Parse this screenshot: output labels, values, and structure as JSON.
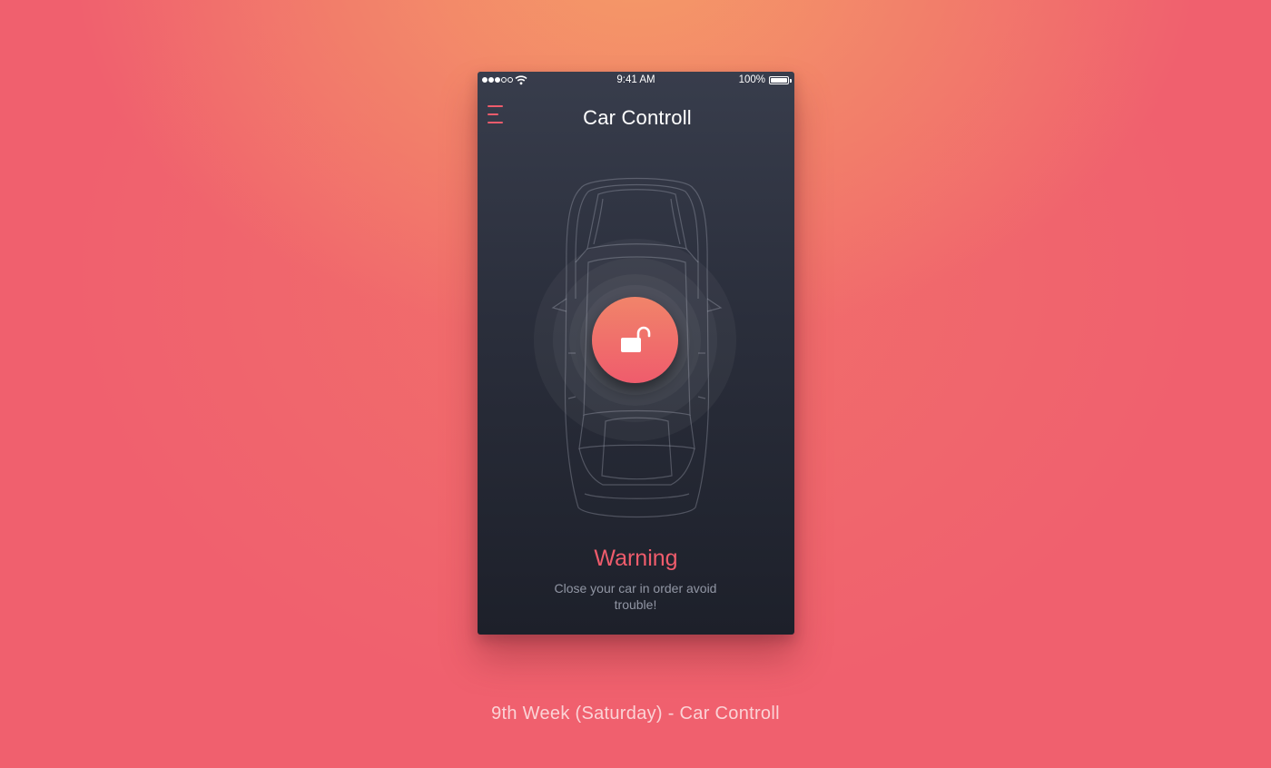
{
  "status_bar": {
    "time": "9:41 AM",
    "battery_percent": "100%",
    "signal_bars_filled": 3,
    "signal_bars_total": 5,
    "wifi_icon": "wifi-icon",
    "battery_icon": "battery-icon"
  },
  "header": {
    "title": "Car Controll",
    "menu_icon": "hamburger-menu-icon"
  },
  "main": {
    "car_icon": "car-top-view-outline",
    "lock_button_icon": "unlocked-padlock-icon",
    "lock_state": "unlocked"
  },
  "warning": {
    "title": "Warning",
    "message": "Close your car in order avoid trouble!"
  },
  "caption": "9th Week (Saturday) - Car Controll",
  "colors": {
    "accent": "#ef5c6c",
    "accent_light": "#f1846a",
    "background_top": "#f49a68",
    "background": "#f0606e",
    "phone_bg_top": "#383d4c",
    "phone_bg_bottom": "#1d202a",
    "muted_text": "#9196a4"
  }
}
